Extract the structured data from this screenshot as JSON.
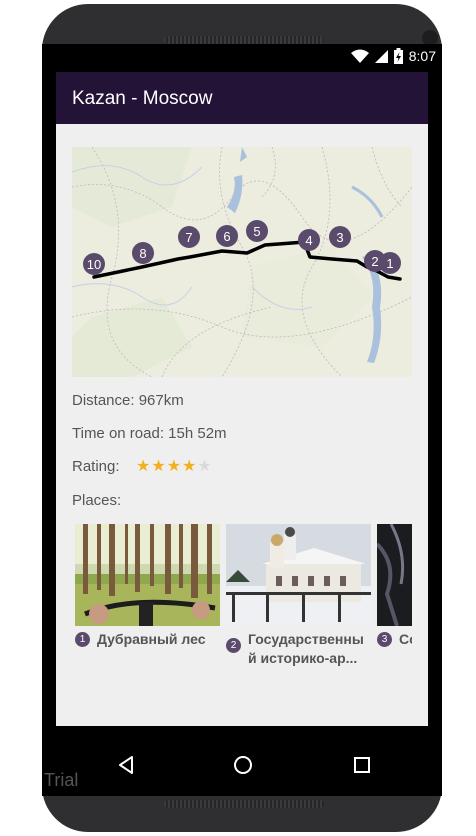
{
  "status_bar": {
    "time": "8:07",
    "icons": [
      "wifi-icon",
      "signal-icon",
      "battery-charging-icon"
    ]
  },
  "app_bar": {
    "title": "Kazan - Moscow"
  },
  "map": {
    "markers": [
      "1",
      "2",
      "3",
      "4",
      "5",
      "6",
      "7",
      "8",
      "10"
    ],
    "route_color": "#000000",
    "marker_color": "#5a4b6c"
  },
  "details": {
    "distance": "Distance: 967km",
    "time_on_road": "Time on road: 15h 52m",
    "rating_label": "Rating:",
    "rating_value": 4,
    "rating_max": 5,
    "places_label": "Places:"
  },
  "places": [
    {
      "number": "1",
      "name": "Дубравный лес"
    },
    {
      "number": "2",
      "name": "Государственны й историко-ар..."
    },
    {
      "number": "3",
      "name": "Со"
    }
  ],
  "nav": {
    "buttons": [
      "back-icon",
      "home-icon",
      "recents-icon"
    ]
  },
  "watermark": "Trial",
  "colors": {
    "app_bar": "#231437",
    "star": "#f2b01e",
    "accent": "#5a4b6c"
  }
}
